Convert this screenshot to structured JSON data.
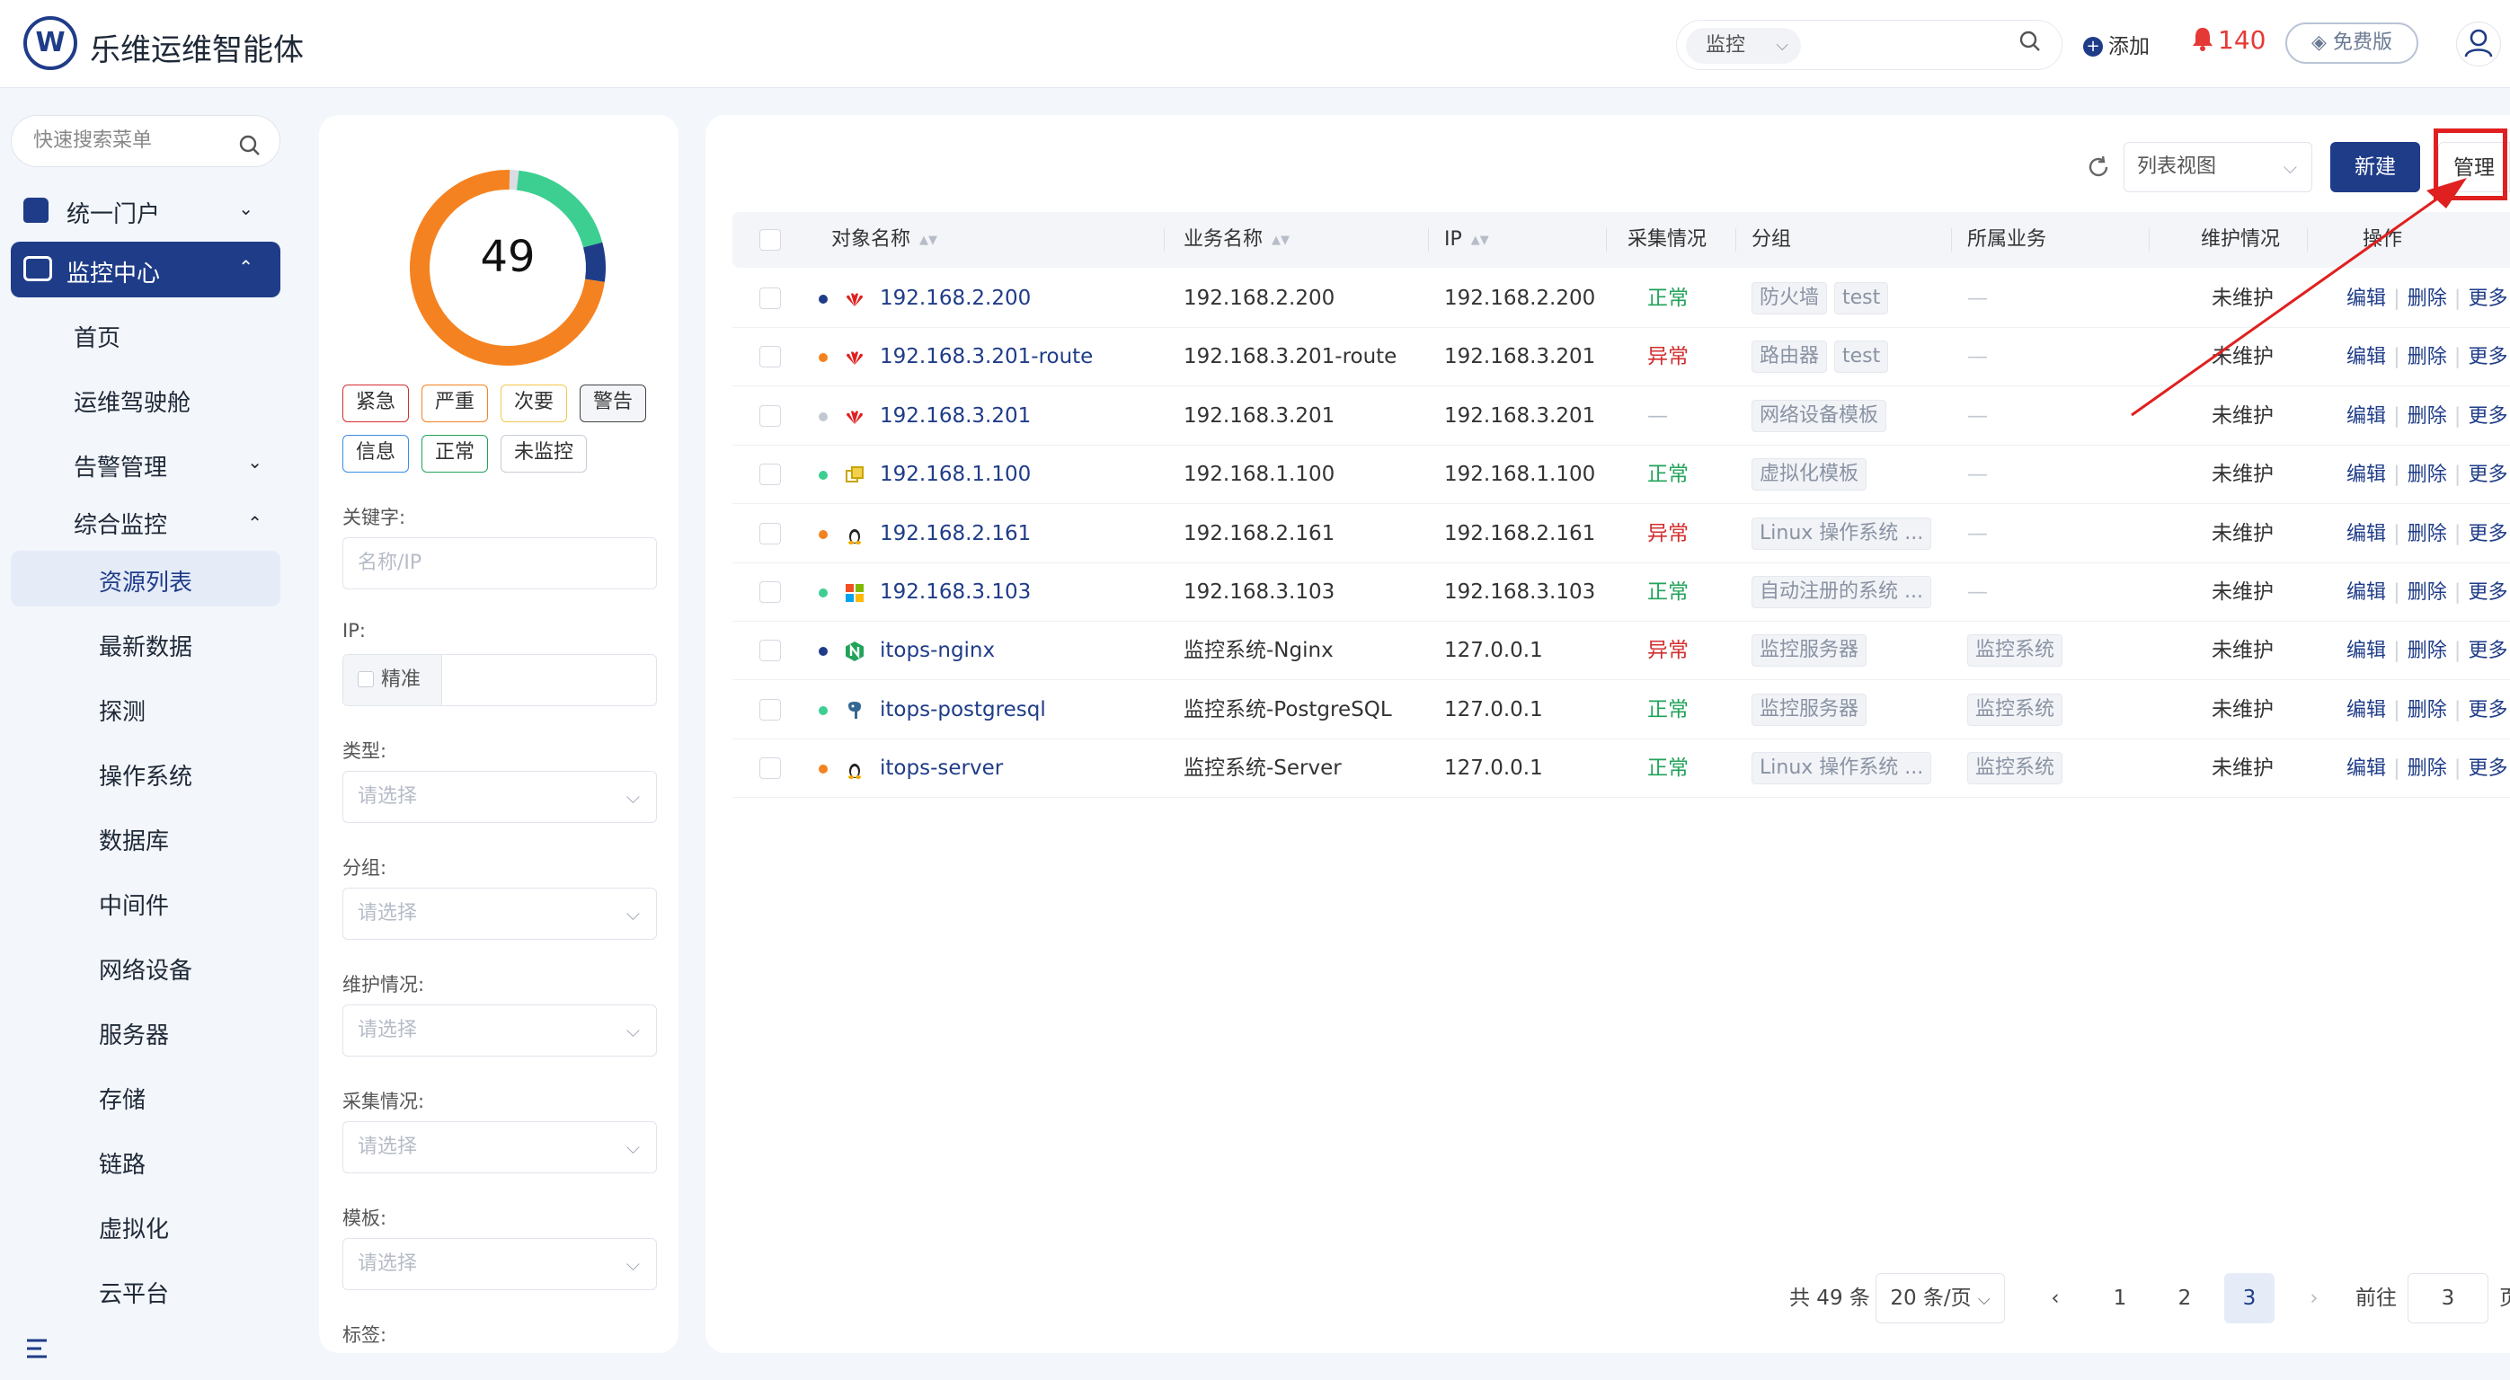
{
  "header": {
    "brand": "乐维运维智能体",
    "search_scope": "监控",
    "add_label": "添加",
    "alert_count": "140",
    "edition_label": "免费版"
  },
  "sidebar": {
    "search_placeholder": "快速搜索菜单",
    "items": {
      "portal": "统一门户",
      "monitor_center": "监控中心",
      "home": "首页",
      "cockpit": "运维驾驶舱",
      "alert_mgmt": "告警管理",
      "integrated": "综合监控",
      "resource_list": "资源列表",
      "latest_data": "最新数据",
      "probe": "探测",
      "os": "操作系统",
      "database": "数据库",
      "middleware": "中间件",
      "network": "网络设备",
      "server": "服务器",
      "storage": "存储",
      "link": "链路",
      "virtual": "虚拟化",
      "cloud": "云平台"
    }
  },
  "filter": {
    "total": "49",
    "tags": {
      "urgent": "紧急",
      "severe": "严重",
      "minor": "次要",
      "warning": "警告",
      "info": "信息",
      "normal": "正常",
      "unmonitored": "未监控"
    },
    "keyword_label": "关键字:",
    "keyword_placeholder": "名称/IP",
    "ip_label": "IP:",
    "precise_label": "精准",
    "type_label": "类型:",
    "group_label": "分组:",
    "maint_label": "维护情况:",
    "collect_label": "采集情况:",
    "template_label": "模板:",
    "tag_label": "标签:",
    "select_placeholder": "请选择"
  },
  "toolbar": {
    "view_label": "列表视图",
    "new_label": "新建",
    "manage_label": "管理"
  },
  "table": {
    "headers": {
      "name": "对象名称",
      "biz_name": "业务名称",
      "ip": "IP",
      "collect": "采集情况",
      "group": "分组",
      "business": "所属业务",
      "maint": "维护情况",
      "ops": "操作"
    },
    "ops": {
      "edit": "编辑",
      "delete": "删除",
      "more": "更多"
    },
    "dash": "—",
    "rows": [
      {
        "name": "192.168.2.200",
        "biz": "192.168.2.200",
        "ip": "192.168.2.200",
        "status": "正常",
        "groups": [
          "防火墙",
          "test"
        ],
        "business": "",
        "maint": "未维护"
      },
      {
        "name": "192.168.3.201-route",
        "biz": "192.168.3.201-route",
        "ip": "192.168.3.201",
        "status": "异常",
        "groups": [
          "路由器",
          "test"
        ],
        "business": "",
        "maint": "未维护"
      },
      {
        "name": "192.168.3.201",
        "biz": "192.168.3.201",
        "ip": "192.168.3.201",
        "status": "",
        "groups": [
          "网络设备模板"
        ],
        "business": "",
        "maint": "未维护"
      },
      {
        "name": "192.168.1.100",
        "biz": "192.168.1.100",
        "ip": "192.168.1.100",
        "status": "正常",
        "groups": [
          "虚拟化模板"
        ],
        "business": "",
        "maint": "未维护"
      },
      {
        "name": "192.168.2.161",
        "biz": "192.168.2.161",
        "ip": "192.168.2.161",
        "status": "异常",
        "groups": [
          "Linux 操作系统 ..."
        ],
        "business": "",
        "maint": "未维护"
      },
      {
        "name": "192.168.3.103",
        "biz": "192.168.3.103",
        "ip": "192.168.3.103",
        "status": "正常",
        "groups": [
          "自动注册的系统 ..."
        ],
        "business": "",
        "maint": "未维护"
      },
      {
        "name": "itops-nginx",
        "biz": "监控系统-Nginx",
        "ip": "127.0.0.1",
        "status": "异常",
        "groups": [
          "监控服务器"
        ],
        "business": "监控系统",
        "maint": "未维护"
      },
      {
        "name": "itops-postgresql",
        "biz": "监控系统-PostgreSQL",
        "ip": "127.0.0.1",
        "status": "正常",
        "groups": [
          "监控服务器"
        ],
        "business": "监控系统",
        "maint": "未维护"
      },
      {
        "name": "itops-server",
        "biz": "监控系统-Server",
        "ip": "127.0.0.1",
        "status": "正常",
        "groups": [
          "Linux 操作系统 ..."
        ],
        "business": "监控系统",
        "maint": "未维护"
      }
    ]
  },
  "pagination": {
    "total_text": "共 49 条",
    "page_size": "20 条/页",
    "pages": [
      "1",
      "2",
      "3"
    ],
    "current_page": "3",
    "goto_label": "前往",
    "goto_value": "3",
    "goto_suffix": "页"
  },
  "colors": {
    "brand": "#1f3c88",
    "ok": "#22a35a",
    "bad": "#d32f2f",
    "annotation": "#e02020",
    "donut_orange": "#f58220",
    "donut_teal": "#3ccf91",
    "donut_navy": "#1f3c88",
    "donut_gray": "#d9dce3"
  }
}
